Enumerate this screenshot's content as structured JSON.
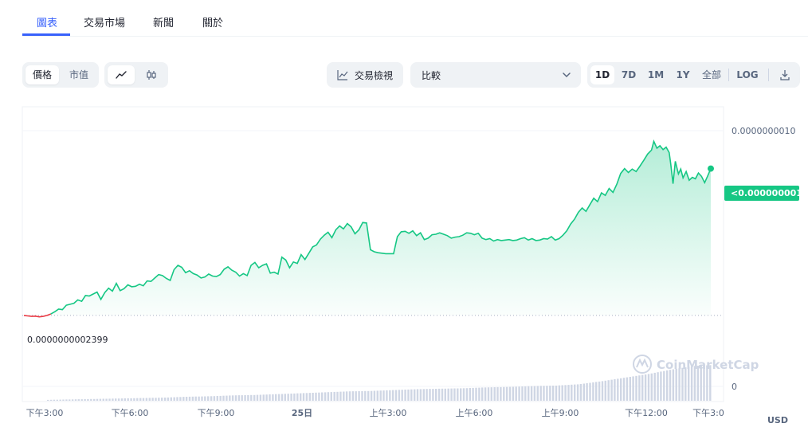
{
  "tabs": [
    "圖表",
    "交易市場",
    "新聞",
    "關於"
  ],
  "toolbar": {
    "price_label": "價格",
    "mcap_label": "市值",
    "trading_view_label": "交易檢視",
    "compare_label": "比較",
    "ranges": [
      "1D",
      "7D",
      "1M",
      "1Y",
      "全部"
    ],
    "log_label": "LOG"
  },
  "colors": {
    "accent": "#3861fb",
    "up": "#16c784",
    "down": "#ea3943",
    "volume": "#cfd6e4"
  },
  "chart_data": {
    "type": "area",
    "y_axis_labels": [
      "0.0000000010",
      "0"
    ],
    "current_price_label": "<0.000000001",
    "baseline_label": "0.0000000002399",
    "currency": "USD",
    "watermark": "CoinMarketCap",
    "x_tick_labels": [
      "下午3:00",
      "下午6:00",
      "下午9:00",
      "25日",
      "上午3:00",
      "上午6:00",
      "上午9:00",
      "下午12:00",
      "下午3:0"
    ],
    "baseline": 2.399e-10,
    "price_series": [
      [
        0,
        2.4e-10
      ],
      [
        5,
        2.38e-10
      ],
      [
        10,
        2.36e-10
      ],
      [
        15,
        2.37e-10
      ],
      [
        20,
        2.34e-10
      ],
      [
        25,
        2.36e-10
      ],
      [
        30,
        2.4e-10
      ],
      [
        35,
        2.46e-10
      ],
      [
        40,
        2.55e-10
      ],
      [
        45,
        2.66e-10
      ],
      [
        50,
        2.64e-10
      ],
      [
        55,
        2.82e-10
      ],
      [
        60,
        2.86e-10
      ],
      [
        65,
        2.9e-10
      ],
      [
        70,
        3.04e-10
      ],
      [
        75,
        2.98e-10
      ],
      [
        80,
        3.22e-10
      ],
      [
        85,
        3.2e-10
      ],
      [
        90,
        3.28e-10
      ],
      [
        95,
        3.36e-10
      ],
      [
        100,
        3.06e-10
      ],
      [
        105,
        3.34e-10
      ],
      [
        110,
        3.52e-10
      ],
      [
        115,
        3.4e-10
      ],
      [
        120,
        3.72e-10
      ],
      [
        125,
        3.42e-10
      ],
      [
        130,
        3.5e-10
      ],
      [
        135,
        3.66e-10
      ],
      [
        140,
        3.58e-10
      ],
      [
        145,
        3.6e-10
      ],
      [
        150,
        3.68e-10
      ],
      [
        155,
        3.62e-10
      ],
      [
        160,
        3.82e-10
      ],
      [
        165,
        3.8e-10
      ],
      [
        170,
        3.94e-10
      ],
      [
        175,
        4.08e-10
      ],
      [
        180,
        4.04e-10
      ],
      [
        185,
        3.92e-10
      ],
      [
        190,
        3.84e-10
      ],
      [
        195,
        4.28e-10
      ],
      [
        200,
        4.46e-10
      ],
      [
        205,
        4.38e-10
      ],
      [
        210,
        4.16e-10
      ],
      [
        215,
        4.24e-10
      ],
      [
        220,
        4.12e-10
      ],
      [
        225,
        4.06e-10
      ],
      [
        230,
        3.94e-10
      ],
      [
        235,
        3.98e-10
      ],
      [
        240,
        4.1e-10
      ],
      [
        245,
        4.02e-10
      ],
      [
        250,
        4e-10
      ],
      [
        255,
        4.08e-10
      ],
      [
        260,
        4.3e-10
      ],
      [
        265,
        4.4e-10
      ],
      [
        270,
        4.26e-10
      ],
      [
        275,
        4.18e-10
      ],
      [
        280,
        4.02e-10
      ],
      [
        285,
        4.12e-10
      ],
      [
        290,
        4.04e-10
      ],
      [
        295,
        4.46e-10
      ],
      [
        300,
        4.58e-10
      ],
      [
        305,
        4.36e-10
      ],
      [
        310,
        4.46e-10
      ],
      [
        315,
        4.52e-10
      ],
      [
        320,
        4.14e-10
      ],
      [
        325,
        4.18e-10
      ],
      [
        330,
        4.1e-10
      ],
      [
        335,
        4.8e-10
      ],
      [
        340,
        4.68e-10
      ],
      [
        345,
        4.36e-10
      ],
      [
        350,
        4.6e-10
      ],
      [
        355,
        4.54e-10
      ],
      [
        360,
        4.9e-10
      ],
      [
        365,
        4.7e-10
      ],
      [
        370,
        4.96e-10
      ],
      [
        375,
        5.22e-10
      ],
      [
        380,
        5.3e-10
      ],
      [
        385,
        5.54e-10
      ],
      [
        390,
        5.7e-10
      ],
      [
        395,
        5.82e-10
      ],
      [
        400,
        5.6e-10
      ],
      [
        405,
        5.92e-10
      ],
      [
        410,
        6.08e-10
      ],
      [
        415,
        5.96e-10
      ],
      [
        420,
        6.18e-10
      ],
      [
        425,
        6.04e-10
      ],
      [
        430,
        5.76e-10
      ],
      [
        435,
        5.92e-10
      ],
      [
        440,
        6.22e-10
      ],
      [
        445,
        6.2e-10
      ],
      [
        450,
        5.1e-10
      ],
      [
        455,
        5.02e-10
      ],
      [
        460,
        4.98e-10
      ],
      [
        465,
        4.96e-10
      ],
      [
        470,
        4.94e-10
      ],
      [
        475,
        4.94e-10
      ],
      [
        480,
        4.94e-10
      ],
      [
        485,
        5.64e-10
      ],
      [
        490,
        5.84e-10
      ],
      [
        495,
        5.86e-10
      ],
      [
        500,
        5.78e-10
      ],
      [
        505,
        5.88e-10
      ],
      [
        510,
        5.68e-10
      ],
      [
        515,
        5.8e-10
      ],
      [
        520,
        5.52e-10
      ],
      [
        525,
        5.58e-10
      ],
      [
        530,
        5.72e-10
      ],
      [
        535,
        5.74e-10
      ],
      [
        540,
        5.8e-10
      ],
      [
        545,
        5.74e-10
      ],
      [
        550,
        5.68e-10
      ],
      [
        555,
        5.58e-10
      ],
      [
        560,
        5.62e-10
      ],
      [
        565,
        5.64e-10
      ],
      [
        570,
        5.7e-10
      ],
      [
        575,
        5.8e-10
      ],
      [
        580,
        5.78e-10
      ],
      [
        585,
        5.72e-10
      ],
      [
        590,
        5.78e-10
      ],
      [
        595,
        5.58e-10
      ],
      [
        600,
        5.52e-10
      ],
      [
        605,
        5.56e-10
      ],
      [
        610,
        5.46e-10
      ],
      [
        615,
        5.52e-10
      ],
      [
        620,
        5.48e-10
      ],
      [
        625,
        5.5e-10
      ],
      [
        630,
        5.52e-10
      ],
      [
        635,
        5.48e-10
      ],
      [
        640,
        5.5e-10
      ],
      [
        645,
        5.56e-10
      ],
      [
        650,
        5.6e-10
      ],
      [
        655,
        5.5e-10
      ],
      [
        660,
        5.56e-10
      ],
      [
        665,
        5.48e-10
      ],
      [
        670,
        5.5e-10
      ],
      [
        675,
        5.56e-10
      ],
      [
        680,
        5.54e-10
      ],
      [
        685,
        5.64e-10
      ],
      [
        690,
        5.5e-10
      ],
      [
        695,
        5.56e-10
      ],
      [
        700,
        5.7e-10
      ],
      [
        705,
        5.88e-10
      ],
      [
        710,
        6.16e-10
      ],
      [
        715,
        6.36e-10
      ],
      [
        720,
        6.64e-10
      ],
      [
        725,
        6.82e-10
      ],
      [
        730,
        6.68e-10
      ],
      [
        735,
        6.96e-10
      ],
      [
        740,
        7.22e-10
      ],
      [
        745,
        7.08e-10
      ],
      [
        750,
        7.44e-10
      ],
      [
        755,
        7.34e-10
      ],
      [
        760,
        7.62e-10
      ],
      [
        765,
        7.46e-10
      ],
      [
        770,
        7.8e-10
      ],
      [
        775,
        8.24e-10
      ],
      [
        780,
        8.44e-10
      ],
      [
        785,
        8.28e-10
      ],
      [
        790,
        8.42e-10
      ],
      [
        795,
        8.32e-10
      ],
      [
        800,
        8.54e-10
      ],
      [
        805,
        8.78e-10
      ],
      [
        810,
        9.04e-10
      ],
      [
        815,
        9.2e-10
      ],
      [
        818,
        9.56e-10
      ],
      [
        822,
        9.28e-10
      ],
      [
        826,
        9.38e-10
      ],
      [
        830,
        9.22e-10
      ],
      [
        834,
        9.32e-10
      ],
      [
        838,
        9.1e-10
      ],
      [
        840,
        8.64e-10
      ],
      [
        843,
        7.82e-10
      ],
      [
        846,
        8.74e-10
      ],
      [
        850,
        8.22e-10
      ],
      [
        853,
        8.42e-10
      ],
      [
        856,
        8.06e-10
      ],
      [
        860,
        8.32e-10
      ],
      [
        864,
        7.96e-10
      ],
      [
        868,
        8.08e-10
      ],
      [
        872,
        8.02e-10
      ],
      [
        876,
        8.26e-10
      ],
      [
        880,
        8.12e-10
      ],
      [
        884,
        7.86e-10
      ],
      [
        888,
        8.14e-10
      ],
      [
        892,
        8.44e-10
      ]
    ],
    "volume_series": [
      [
        30,
        0.02
      ],
      [
        60,
        0.03
      ],
      [
        90,
        0.04
      ],
      [
        120,
        0.05
      ],
      [
        150,
        0.06
      ],
      [
        180,
        0.07
      ],
      [
        210,
        0.09
      ],
      [
        240,
        0.1
      ],
      [
        270,
        0.12
      ],
      [
        300,
        0.13
      ],
      [
        330,
        0.15
      ],
      [
        360,
        0.17
      ],
      [
        390,
        0.19
      ],
      [
        420,
        0.21
      ],
      [
        450,
        0.22
      ],
      [
        480,
        0.24
      ],
      [
        510,
        0.26
      ],
      [
        540,
        0.27
      ],
      [
        570,
        0.28
      ],
      [
        600,
        0.3
      ],
      [
        630,
        0.31
      ],
      [
        660,
        0.33
      ],
      [
        690,
        0.34
      ],
      [
        720,
        0.37
      ],
      [
        750,
        0.44
      ],
      [
        780,
        0.52
      ],
      [
        810,
        0.6
      ],
      [
        840,
        0.7
      ],
      [
        870,
        0.78
      ],
      [
        892,
        0.8
      ]
    ]
  }
}
